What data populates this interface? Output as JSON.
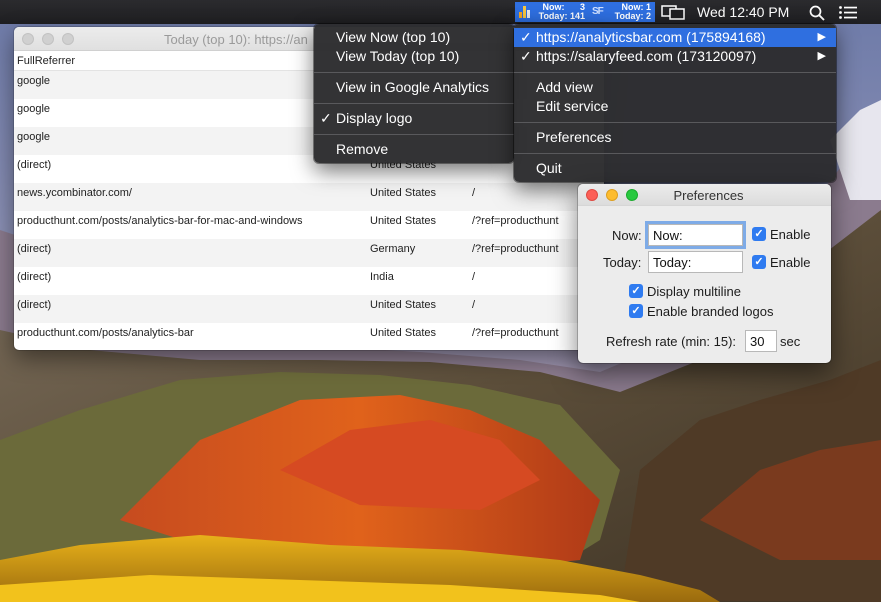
{
  "menubar": {
    "analytics_status": {
      "site1": {
        "now_label": "Now:",
        "now_value": "3",
        "today_label": "Today:",
        "today_value": "141"
      },
      "site2_icon": "SF",
      "site2": {
        "now_label": "Now:",
        "now_value": "1",
        "today_label": "Today:",
        "today_value": "2"
      }
    },
    "clock": "Wed 12:40 PM",
    "icons": [
      "analytics-bar-logo-icon",
      "display-mirror-icon",
      "spotlight-search-icon",
      "notification-list-icon"
    ],
    "accent_color": "#2f6fe0"
  },
  "table_window": {
    "title": "Today (top 10): https://an",
    "column_header": "FullReferrer",
    "rows": [
      {
        "referrer": "google",
        "country": "",
        "path": ""
      },
      {
        "referrer": "google",
        "country": "",
        "path": ""
      },
      {
        "referrer": "google",
        "country": "",
        "path": ""
      },
      {
        "referrer": "(direct)",
        "country": "United States",
        "path": ""
      },
      {
        "referrer": "news.ycombinator.com/",
        "country": "United States",
        "path": "/"
      },
      {
        "referrer": "producthunt.com/posts/analytics-bar-for-mac-and-windows",
        "country": "United States",
        "path": "/?ref=producthunt"
      },
      {
        "referrer": "(direct)",
        "country": "Germany",
        "path": "/?ref=producthunt"
      },
      {
        "referrer": "(direct)",
        "country": "India",
        "path": "/"
      },
      {
        "referrer": "(direct)",
        "country": "United States",
        "path": "/"
      },
      {
        "referrer": "producthunt.com/posts/analytics-bar",
        "country": "United States",
        "path": "/?ref=producthunt"
      }
    ]
  },
  "menu_left": {
    "items": [
      {
        "label": "View Now (top 10)"
      },
      {
        "label": "View Today (top 10)"
      },
      {
        "label": "View in Google Analytics"
      },
      {
        "label": "Display logo",
        "checked": true
      },
      {
        "label": "Remove"
      }
    ]
  },
  "menu_right": {
    "items": [
      {
        "label": "https://analyticsbar.com (175894168)",
        "checked": true,
        "selected": true,
        "submenu": true
      },
      {
        "label": "https://salaryfeed.com (173120097)",
        "checked": true,
        "submenu": true
      },
      {
        "label": "Add view"
      },
      {
        "label": "Edit service"
      },
      {
        "label": "Preferences"
      },
      {
        "label": "Quit"
      }
    ],
    "check_glyph": "✓",
    "arrow_glyph": "▶"
  },
  "preferences": {
    "title": "Preferences",
    "now_label": "Now:",
    "now_value": "Now:",
    "today_label": "Today:",
    "today_value": "Today:",
    "enable_label": "Enable",
    "multiline_label": "Display multiline",
    "branded_logos_label": "Enable branded logos",
    "refresh_label": "Refresh rate (min: 15):",
    "refresh_value": "30",
    "refresh_unit": "sec"
  }
}
